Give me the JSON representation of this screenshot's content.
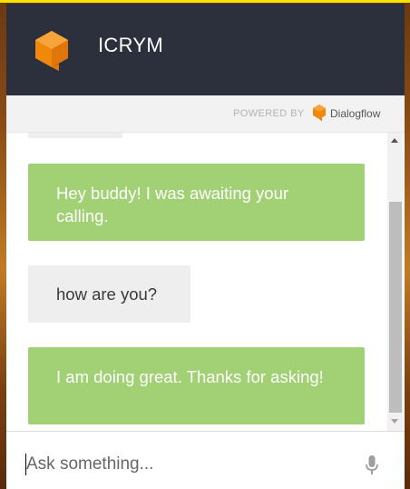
{
  "header": {
    "title": "ICRYM"
  },
  "powered_by": {
    "label": "POWERED BY",
    "brand": "Dialogflow"
  },
  "messages": [
    {
      "from": "user",
      "text": ""
    },
    {
      "from": "bot",
      "text": "Hey buddy! I was awaiting your calling."
    },
    {
      "from": "user",
      "text": "how are you?"
    },
    {
      "from": "bot",
      "text": "I am doing great. Thanks for asking!"
    }
  ],
  "input": {
    "placeholder": "Ask something...",
    "value": ""
  },
  "colors": {
    "header_bg": "#2c2f3c",
    "bot_bubble": "#a2d075",
    "user_bubble": "#eeeeee",
    "accent_orange": "#f0890b"
  },
  "icons": [
    "dialogflow-logo-icon",
    "microphone-icon",
    "scroll-up-arrow-icon",
    "scroll-down-arrow-icon"
  ]
}
